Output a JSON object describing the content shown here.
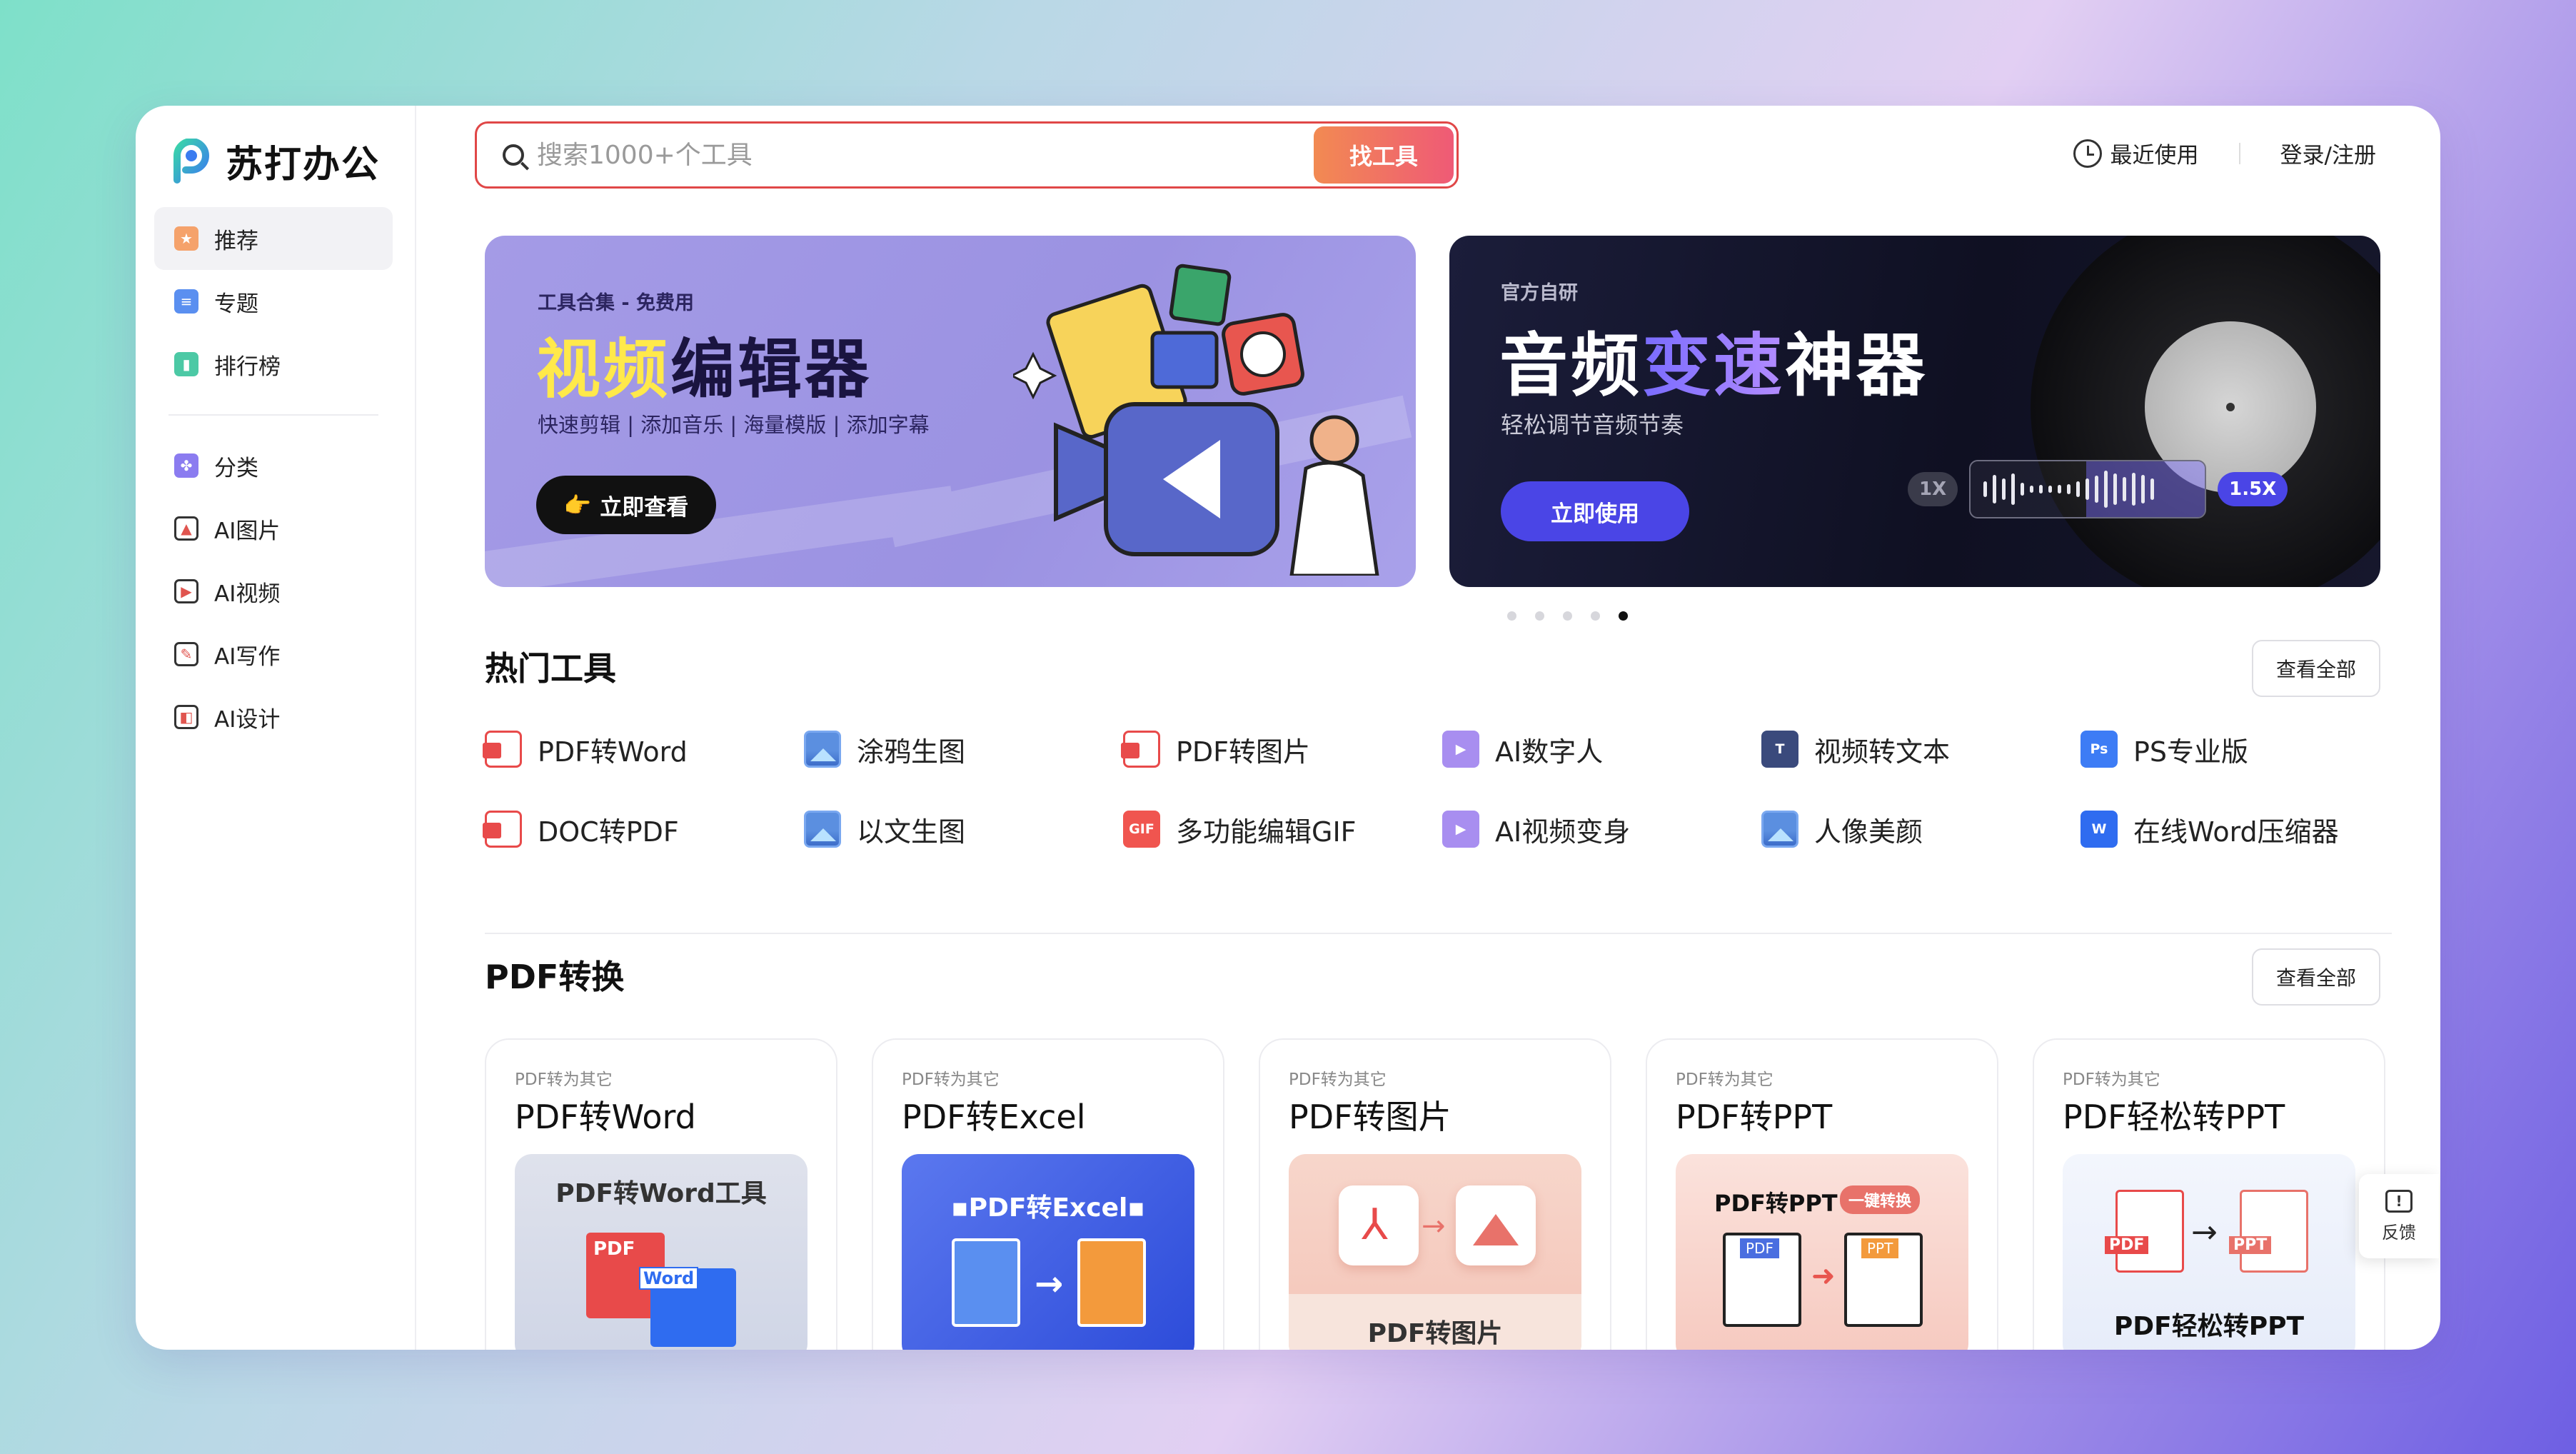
{
  "app": {
    "name": "苏打办公"
  },
  "sidebar": {
    "primary": [
      {
        "label": "推荐",
        "icon": "star-icon",
        "active": true
      },
      {
        "label": "专题",
        "icon": "bookmark-icon"
      },
      {
        "label": "排行榜",
        "icon": "ranking-icon"
      }
    ],
    "secondary": [
      {
        "label": "分类",
        "icon": "category-icon"
      },
      {
        "label": "AI图片",
        "icon": "image-icon"
      },
      {
        "label": "AI视频",
        "icon": "video-icon"
      },
      {
        "label": "AI写作",
        "icon": "pen-icon"
      },
      {
        "label": "AI设计",
        "icon": "design-icon"
      }
    ]
  },
  "header": {
    "search_placeholder": "搜索1000+个工具",
    "search_button": "找工具",
    "recent_label": "最近使用",
    "login_label": "登录/注册"
  },
  "banners": [
    {
      "kicker": "工具合集 - 免费用",
      "title_highlight": "视频",
      "title_rest": "编辑器",
      "subtitle": "快速剪辑 | 添加音乐 | 海量模版 | 添加字幕",
      "button": "立即查看",
      "button_icon": "👉"
    },
    {
      "kicker": "官方自研",
      "title_a": "音频",
      "title_highlight": "变速",
      "title_b": "神器",
      "subtitle": "轻松调节音频节奏",
      "button": "立即使用",
      "speed_low": "1X",
      "speed_high": "1.5X"
    }
  ],
  "carousel": {
    "count": 5,
    "active_index": 4
  },
  "hot_tools": {
    "title": "热门工具",
    "view_all": "查看全部",
    "items": [
      {
        "label": "PDF转Word",
        "icon": "pdf-icon"
      },
      {
        "label": "涂鸦生图",
        "icon": "image-icon"
      },
      {
        "label": "PDF转图片",
        "icon": "pdf-icon"
      },
      {
        "label": "AI数字人",
        "icon": "ai-video-icon"
      },
      {
        "label": "视频转文本",
        "icon": "text-icon"
      },
      {
        "label": "PS专业版",
        "icon": "ps-icon",
        "badge": "Ps"
      },
      {
        "label": "DOC转PDF",
        "icon": "pdf-icon"
      },
      {
        "label": "以文生图",
        "icon": "image-icon"
      },
      {
        "label": "多功能编辑GIF",
        "icon": "gif-icon",
        "badge": "GIF"
      },
      {
        "label": "AI视频变身",
        "icon": "ai-video-icon"
      },
      {
        "label": "人像美颜",
        "icon": "image-icon"
      },
      {
        "label": "在线Word压缩器",
        "icon": "word-icon",
        "badge": "W"
      }
    ]
  },
  "pdf_section": {
    "title": "PDF转换",
    "view_all": "查看全部",
    "cards": [
      {
        "category": "PDF转为其它",
        "name": "PDF转Word",
        "thumb_title": "PDF转Word工具",
        "doc_a": "PDF",
        "doc_b": "Word"
      },
      {
        "category": "PDF转为其它",
        "name": "PDF转Excel",
        "thumb_title": "▪PDF转Excel▪"
      },
      {
        "category": "PDF转为其它",
        "name": "PDF转图片",
        "thumb_title": "PDF转图片"
      },
      {
        "category": "PDF转为其它",
        "name": "PDF转PPT",
        "thumb_title": "PDF转PPT",
        "tag": "一键转换",
        "doc_a": "PDF",
        "doc_b": "PPT"
      },
      {
        "category": "PDF转为其它",
        "name": "PDF轻松转PPT",
        "thumb_title": "PDF轻松转PPT",
        "doc_a": "PDF",
        "doc_b": "PPT"
      }
    ]
  },
  "feedback": {
    "label": "反馈"
  },
  "colors": {
    "accent": "#4a45e6",
    "search_border": "#e04747",
    "highlight_yellow": "#ffe94a"
  }
}
